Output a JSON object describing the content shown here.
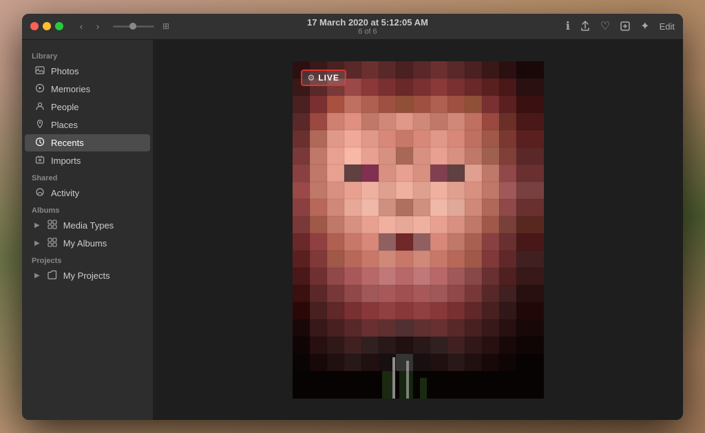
{
  "window": {
    "title": "17 March 2020 at 5:12:05 AM",
    "subtitle": "6 of 6"
  },
  "titlebar": {
    "traffic_lights": [
      "close",
      "minimize",
      "maximize"
    ],
    "nav_back": "‹",
    "nav_forward": "›",
    "edit_label": "Edit"
  },
  "toolbar_icons": {
    "info": "ℹ",
    "share": "↑",
    "favorite": "♡",
    "rotate": "↺",
    "adjust": "✦"
  },
  "sidebar": {
    "sections": [
      {
        "label": "Library",
        "items": [
          {
            "id": "photos",
            "label": "Photos",
            "icon": "🖼",
            "active": false
          },
          {
            "id": "memories",
            "label": "Memories",
            "icon": "▶",
            "active": false
          },
          {
            "id": "people",
            "label": "People",
            "icon": "👤",
            "active": false
          },
          {
            "id": "places",
            "label": "Places",
            "icon": "📍",
            "active": false
          },
          {
            "id": "recents",
            "label": "Recents",
            "icon": "🕐",
            "active": true
          },
          {
            "id": "imports",
            "label": "Imports",
            "icon": "📷",
            "active": false
          }
        ]
      },
      {
        "label": "Shared",
        "items": [
          {
            "id": "activity",
            "label": "Activity",
            "icon": "☁",
            "active": false
          }
        ]
      },
      {
        "label": "Albums",
        "items": [
          {
            "id": "media-types",
            "label": "Media Types",
            "icon": "▦",
            "active": false,
            "collapsible": true
          },
          {
            "id": "my-albums",
            "label": "My Albums",
            "icon": "▦",
            "active": false,
            "collapsible": true
          }
        ]
      },
      {
        "label": "Projects",
        "items": [
          {
            "id": "my-projects",
            "label": "My Projects",
            "icon": "📁",
            "active": false,
            "collapsible": true
          }
        ]
      }
    ]
  },
  "live_badge": {
    "icon": "⚙",
    "label": "LIVE",
    "border_color": "#e03030"
  },
  "photo": {
    "description": "Pixelated portrait photo"
  }
}
